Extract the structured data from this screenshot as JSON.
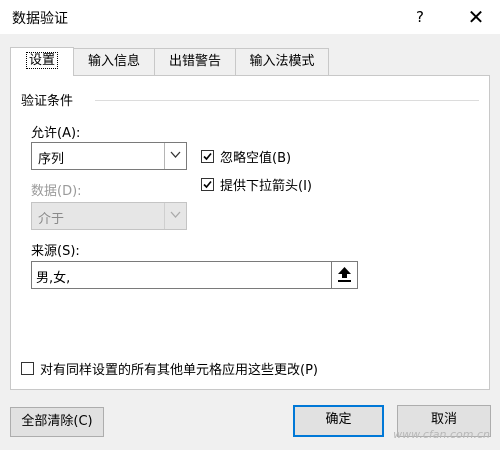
{
  "window": {
    "title": "数据验证",
    "help_symbol": "?",
    "close_symbol": "✕"
  },
  "tabs": [
    {
      "label": "设置",
      "active": true
    },
    {
      "label": "输入信息",
      "active": false
    },
    {
      "label": "出错警告",
      "active": false
    },
    {
      "label": "输入法模式",
      "active": false
    }
  ],
  "criteria": {
    "group_title": "验证条件",
    "allow_label": "允许(A):",
    "allow_value": "序列",
    "data_label": "数据(D):",
    "data_value": "介于",
    "ignore_blank": {
      "label": "忽略空值(B)",
      "checked": true
    },
    "in_cell_dropdown": {
      "label": "提供下拉箭头(I)",
      "checked": true
    },
    "source_label": "来源(S):",
    "source_value": "男,女,"
  },
  "apply_all": {
    "label": "对有同样设置的所有其他单元格应用这些更改(P)",
    "checked": false
  },
  "buttons": {
    "clear_all": "全部清除(C)",
    "ok": "确定",
    "cancel": "取消"
  },
  "watermark": "www.cfan.com.cn",
  "colors": {
    "accent": "#0078d7",
    "dialog_bg": "#f0f0f0",
    "disabled_text": "#9a9a9a"
  },
  "icons": {
    "dropdown": "chevron-down-icon",
    "collapse": "collapse-dialog-icon",
    "check": "checkmark-icon"
  }
}
